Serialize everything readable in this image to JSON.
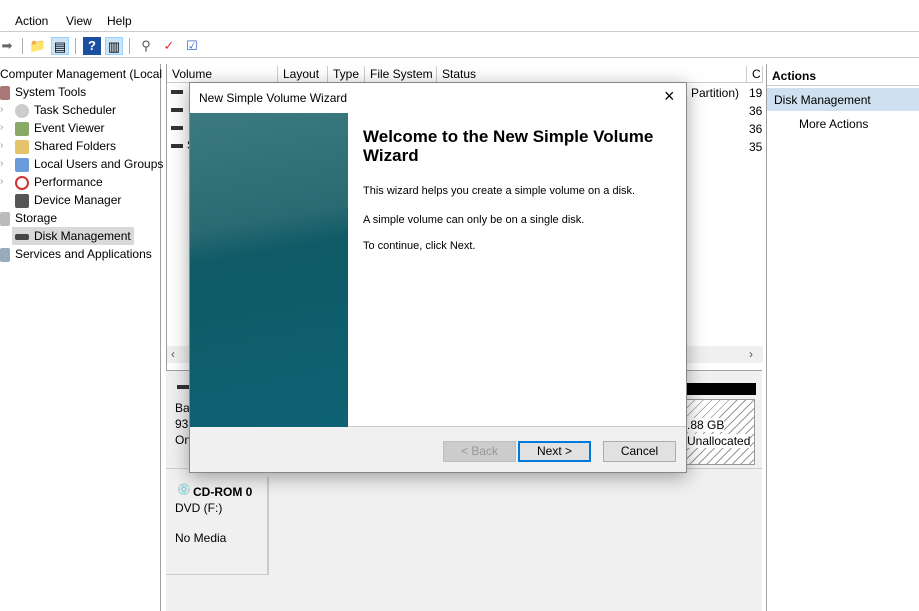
{
  "menu": [
    "Action",
    "View",
    "Help"
  ],
  "tree": {
    "root": "Computer Management (Local",
    "items": [
      {
        "label": "System Tools",
        "level": 0
      },
      {
        "label": "Task Scheduler",
        "level": 1
      },
      {
        "label": "Event Viewer",
        "level": 1
      },
      {
        "label": "Shared Folders",
        "level": 1
      },
      {
        "label": "Local Users and Groups",
        "level": 1
      },
      {
        "label": "Performance",
        "level": 1
      },
      {
        "label": "Device Manager",
        "level": 1
      },
      {
        "label": "Storage",
        "level": 0
      },
      {
        "label": "Disk Management",
        "level": 1,
        "selected": true
      },
      {
        "label": "Services and Applications",
        "level": 0
      }
    ]
  },
  "volumes": {
    "columns": [
      "Volume",
      "Layout",
      "Type",
      "File System",
      "Status",
      "C"
    ],
    "status_partial": "Partition)",
    "capacity_partial": [
      "19",
      "36",
      "36",
      "35"
    ],
    "row4_partial": "S"
  },
  "disks": {
    "disk0": {
      "line1": "Bas",
      "line2": "93",
      "line3": "On",
      "unalloc_size": ".88 GB",
      "unalloc_label": "Unallocated"
    },
    "cdrom": {
      "name": "CD-ROM 0",
      "type": "DVD (F:)",
      "status": "No Media"
    }
  },
  "actions": {
    "header": "Actions",
    "section": "Disk Management",
    "more": "More Actions"
  },
  "dialog": {
    "title": "New Simple Volume Wizard",
    "heading": "Welcome to the New Simple Volume Wizard",
    "p1": "This wizard helps you create a simple volume on a disk.",
    "p2": "A simple volume can only be on a single disk.",
    "p3": "To continue, click Next.",
    "back": "< Back",
    "next": "Next >",
    "cancel": "Cancel"
  },
  "colors": {
    "selection": "#cce4f7",
    "banner": "#0e5a66",
    "focus": "#0078d7"
  }
}
